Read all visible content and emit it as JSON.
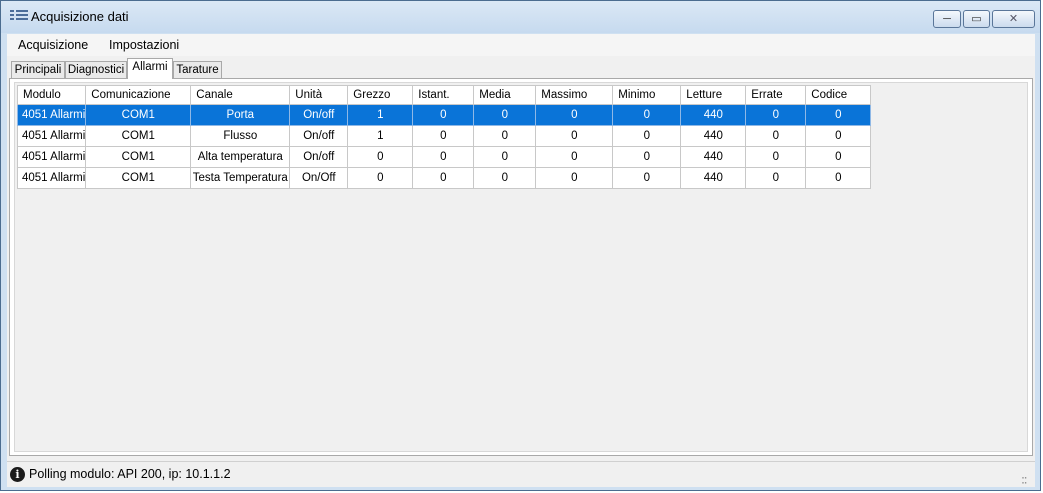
{
  "window": {
    "title": "Acquisizione dati",
    "min_label": "─",
    "max_label": "▭",
    "close_label": "✕"
  },
  "menu": {
    "items": [
      "Acquisizione",
      "Impostazioni"
    ]
  },
  "tabs": [
    "Principali",
    "Diagnostici",
    "Allarmi",
    "Tarature"
  ],
  "active_tab": "Allarmi",
  "table": {
    "columns": [
      "Modulo",
      "Comunicazione",
      "Canale",
      "Unità",
      "Grezzo",
      "Istant.",
      "Media",
      "Massimo",
      "Minimo",
      "Letture",
      "Errate",
      "Codice"
    ],
    "rows": [
      [
        "4051 Allarmi",
        "COM1",
        "Porta",
        "On/off",
        "1",
        "0",
        "0",
        "0",
        "0",
        "440",
        "0",
        "0"
      ],
      [
        "4051 Allarmi",
        "COM1",
        "Flusso",
        "On/off",
        "1",
        "0",
        "0",
        "0",
        "0",
        "440",
        "0",
        "0"
      ],
      [
        "4051 Allarmi",
        "COM1",
        "Alta temperatura",
        "On/off",
        "0",
        "0",
        "0",
        "0",
        "0",
        "440",
        "0",
        "0"
      ],
      [
        "4051 Allarmi",
        "COM1",
        "Testa Temperatura",
        "On/Off",
        "0",
        "0",
        "0",
        "0",
        "0",
        "440",
        "0",
        "0"
      ]
    ],
    "selected_row": 0
  },
  "status": {
    "text": "Polling modulo: API 200, ip: 10.1.1.2",
    "icon": "info-icon"
  },
  "colors": {
    "selection": "#0a74d8",
    "titlebar": "#c6daef"
  }
}
